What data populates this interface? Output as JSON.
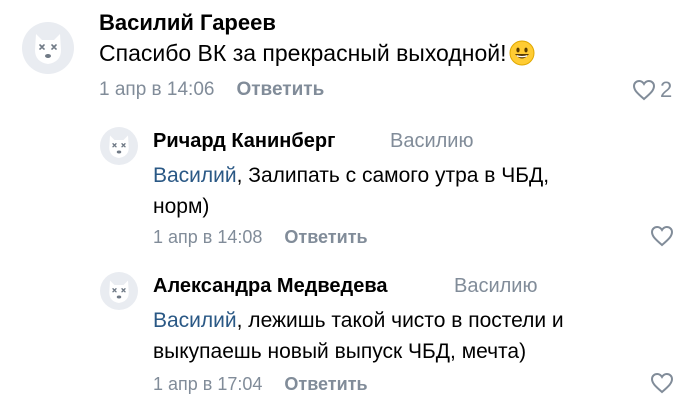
{
  "colors": {
    "link": "#2a5885",
    "secondary": "#818c99",
    "avatar_bg": "#e9ecf1"
  },
  "comments": [
    {
      "author": "Василий Гареев",
      "text": "Спасибо ВК за прекрасный выходной!",
      "emoji": "grinning-face-emoji",
      "time": "1 апр в 14:06",
      "reply_label": "Ответить",
      "likes": "2"
    },
    {
      "author": "Ричард Канинберг",
      "reply_to": "Василию",
      "mention": "Василий",
      "text_line1": ", Залипать с самого утра в ЧБД,",
      "text_line2": "норм)",
      "time": "1 апр в 14:08",
      "reply_label": "Ответить"
    },
    {
      "author": "Александра Медведева",
      "reply_to": "Василию",
      "mention": "Василий",
      "text_line1": ", лежишь такой чисто в постели и",
      "text_line2": "выкупаешь новый выпуск ЧБД, мечта)",
      "time": "1 апр в 17:04",
      "reply_label": "Ответить"
    }
  ]
}
